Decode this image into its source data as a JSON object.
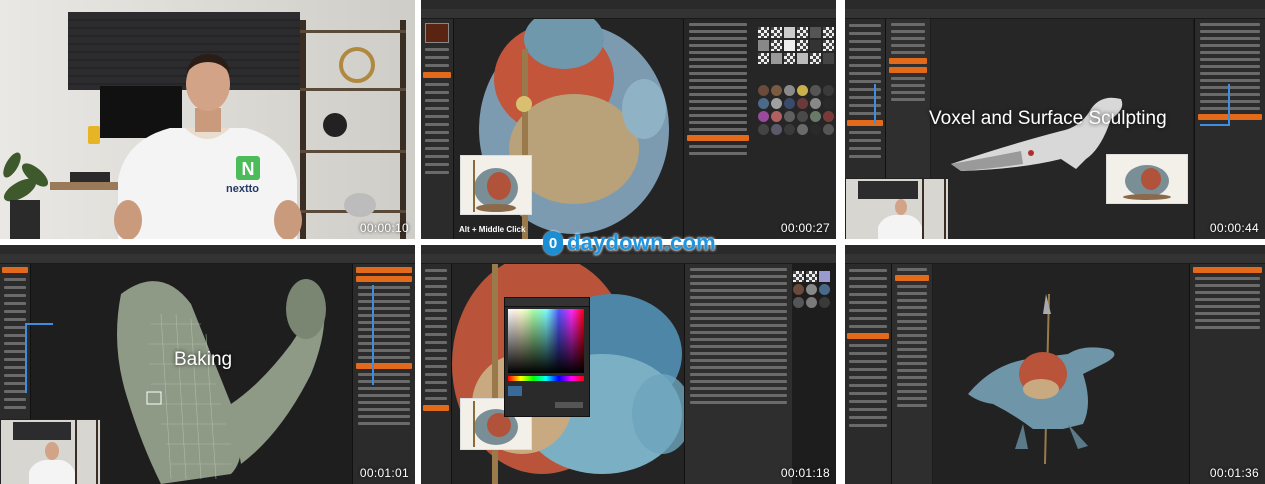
{
  "tiles": [
    {
      "id": "intro",
      "timestamp": "00:00:10",
      "logo_letter": "N",
      "shirt_text": "nextto"
    },
    {
      "id": "painting",
      "timestamp": "00:00:27",
      "hint": "Alt + Middle Click"
    },
    {
      "id": "sculpting",
      "timestamp": "00:00:44",
      "caption": "Voxel and Surface Sculpting"
    },
    {
      "id": "baking",
      "timestamp": "00:01:01",
      "caption": "Baking"
    },
    {
      "id": "color-picker",
      "timestamp": "00:01:18"
    },
    {
      "id": "final-render",
      "timestamp": "00:01:36"
    }
  ],
  "watermark": {
    "badge": "0",
    "text": "daydown.com",
    "color": "#1a8fd6"
  },
  "colors": {
    "accent": "#e36a1a",
    "panel": "#2b2b2b",
    "viewport": "#242424",
    "highlight": "#3d8ee0"
  },
  "icons": [
    "record-icon",
    "watermark-logo-icon"
  ]
}
